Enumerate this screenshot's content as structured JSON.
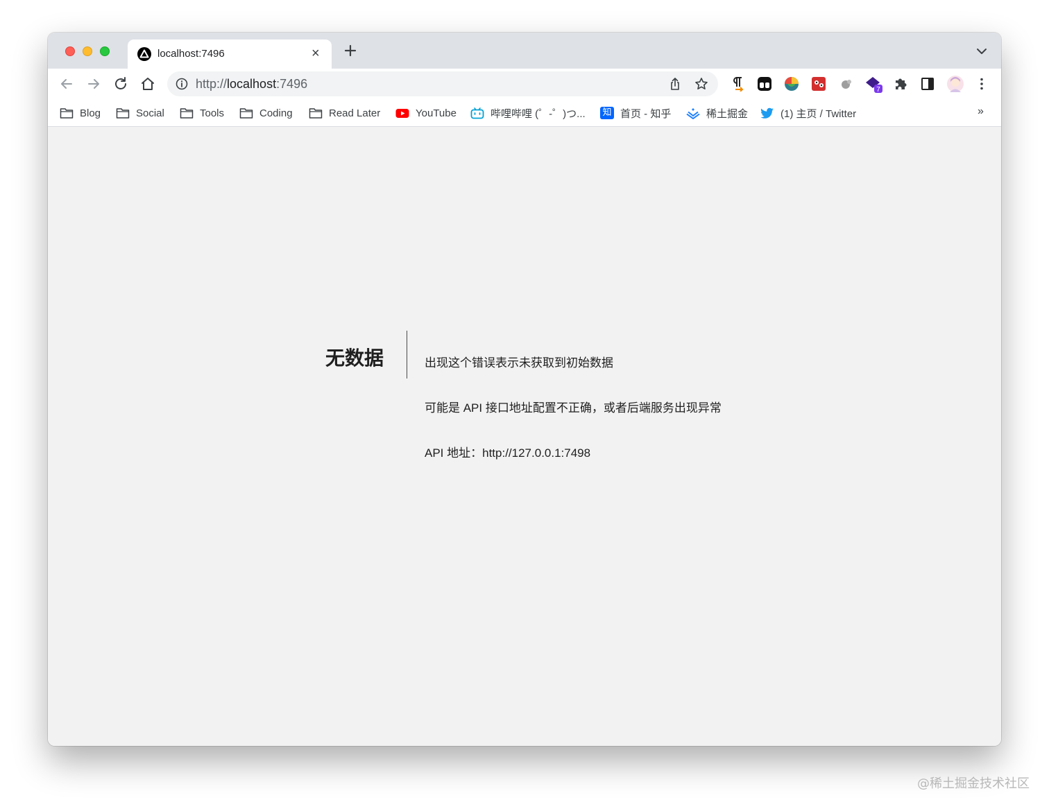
{
  "tab": {
    "title": "localhost:7496",
    "close_glyph": "×",
    "favicon": "triangle-logo-icon"
  },
  "toolbar": {
    "url_scheme": "http://",
    "url_host": "localhost",
    "url_port": ":7496",
    "extensions": [
      "paragraph-extension-icon",
      "tweetdeck-extension-icon",
      "colorful-extension-icon",
      "red-extension-icon",
      "gray-extension-icon",
      "badge-extension-icon",
      "puzzle-extensions-icon",
      "side-panel-icon",
      "profile-avatar",
      "menu-icon"
    ],
    "extension_badge": "7"
  },
  "bookmarks": {
    "items": [
      {
        "label": "Blog",
        "icon": "folder-icon"
      },
      {
        "label": "Social",
        "icon": "folder-icon"
      },
      {
        "label": "Tools",
        "icon": "folder-icon"
      },
      {
        "label": "Coding",
        "icon": "folder-icon"
      },
      {
        "label": "Read Later",
        "icon": "folder-icon"
      },
      {
        "label": "YouTube",
        "icon": "youtube-icon"
      },
      {
        "label": "哔哩哔哩 (゜-゜)つ...",
        "icon": "bilibili-icon"
      },
      {
        "label": "首页 - 知乎",
        "icon": "zhihu-icon"
      },
      {
        "label": "稀土掘金",
        "icon": "juejin-icon"
      },
      {
        "label": "(1) 主页 / Twitter",
        "icon": "twitter-icon"
      }
    ],
    "more": "»",
    "zhihu_glyph": "知"
  },
  "error": {
    "title": "无数据",
    "line1": "出现这个错误表示未获取到初始数据",
    "line2": "可能是 API 接口地址配置不正确，或者后端服务出现异常",
    "line3": "API 地址：http://127.0.0.1:7498"
  },
  "watermark": "@稀土掘金技术社区",
  "colors": {
    "chrome_frame": "#dee1e6",
    "page_background": "#f2f2f2",
    "youtube": "#ff0000",
    "bilibili": "#00a1d6",
    "zhihu": "#0066ff",
    "juejin": "#1e80ff",
    "twitter": "#1d9bf0"
  }
}
